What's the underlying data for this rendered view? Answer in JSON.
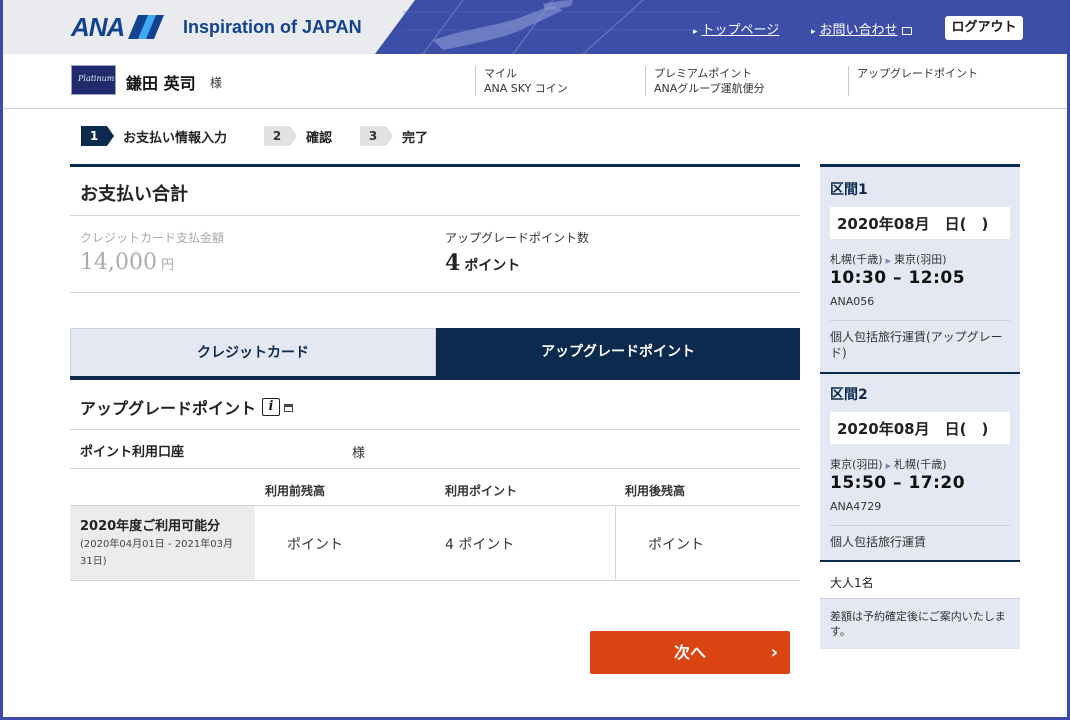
{
  "header": {
    "logo": "ANA",
    "tagline": "Inspiration of JAPAN",
    "top_link": "トップページ",
    "contact_link": "お問い合わせ",
    "logout": "ログアウト"
  },
  "user": {
    "card_text": "Platinum",
    "name": "鎌田 英司",
    "honorific": "様",
    "col1_line1": "マイル",
    "col1_line2": "ANA SKY コイン",
    "col2_line1": "プレミアムポイント",
    "col2_line2": "ANAグループ運航便分",
    "col3_line1": "アップグレードポイント"
  },
  "steps": [
    {
      "num": "1",
      "label": "お支払い情報入力"
    },
    {
      "num": "2",
      "label": "確認"
    },
    {
      "num": "3",
      "label": "完了"
    }
  ],
  "summary": {
    "title": "お支払い合計",
    "credit_label": "クレジットカード支払金額",
    "credit_value": "14,000",
    "credit_unit": "円",
    "points_label": "アップグレードポイント数",
    "points_value": "4",
    "points_unit": "ポイント"
  },
  "tabs": {
    "credit": "クレジットカード",
    "points": "アップグレードポイント"
  },
  "upgrade": {
    "title": "アップグレードポイント",
    "info_icon": "i",
    "account_label": "ポイント利用口座",
    "account_sama": "様",
    "col_before": "利用前残高",
    "col_use": "利用ポイント",
    "col_after": "利用後残高",
    "row_title": "2020年度ご利用可能分",
    "row_period": "(2020年04月01日 - 2021年03月31日)",
    "before_value": "ポイント",
    "use_value": "4 ポイント",
    "after_value": "ポイント"
  },
  "next_button": "次へ",
  "sidebar": {
    "seg1": {
      "title": "区間1",
      "date": "2020年08月　日(　)",
      "from": "札幌(千歳)",
      "to": "東京(羽田)",
      "time": "10:30 – 12:05",
      "flight": "ANA056",
      "fare": "個人包括旅行運賃(アップグレード)"
    },
    "seg2": {
      "title": "区間2",
      "date": "2020年08月　日(　)",
      "from": "東京(羽田)",
      "to": "札幌(千歳)",
      "time": "15:50 – 17:20",
      "flight": "ANA4729",
      "fare": "個人包括旅行運賃"
    },
    "passengers": "大人1名",
    "note": "差額は予約確定後にご案内いたします。"
  }
}
